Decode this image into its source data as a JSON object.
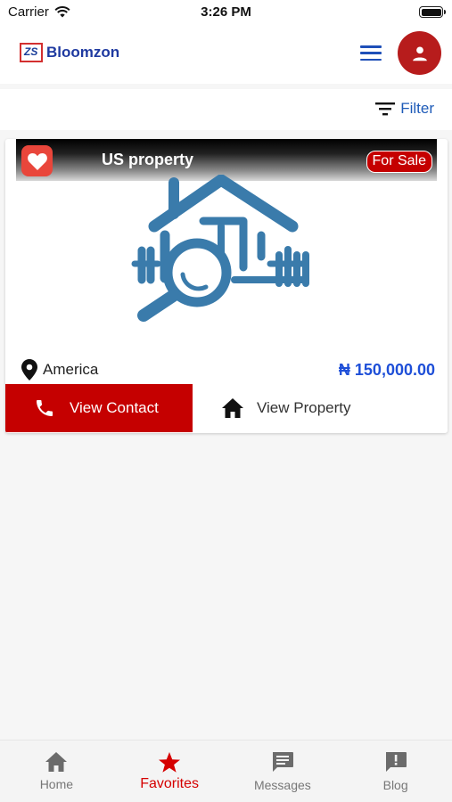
{
  "status": {
    "carrier": "Carrier",
    "time": "3:26 PM"
  },
  "app": {
    "logo_mark": "ZS",
    "logo_text": "Bloomzon"
  },
  "filter": {
    "label": "Filter"
  },
  "listing": {
    "title": "US property",
    "badge": "For Sale",
    "location": "America",
    "price": "₦ 150,000.00",
    "contact_label": "View Contact",
    "view_label": "View Property"
  },
  "nav": {
    "items": [
      {
        "label": "Home",
        "icon": "home-icon"
      },
      {
        "label": "Favorites",
        "icon": "star-icon"
      },
      {
        "label": "Messages",
        "icon": "message-icon"
      },
      {
        "label": "Blog",
        "icon": "announcement-icon"
      }
    ],
    "active_index": 1
  },
  "colors": {
    "primary_red": "#c50000",
    "brand_blue": "#1f3aa0",
    "price_blue": "#1e4fd8",
    "house_blue": "#3a7bab"
  }
}
